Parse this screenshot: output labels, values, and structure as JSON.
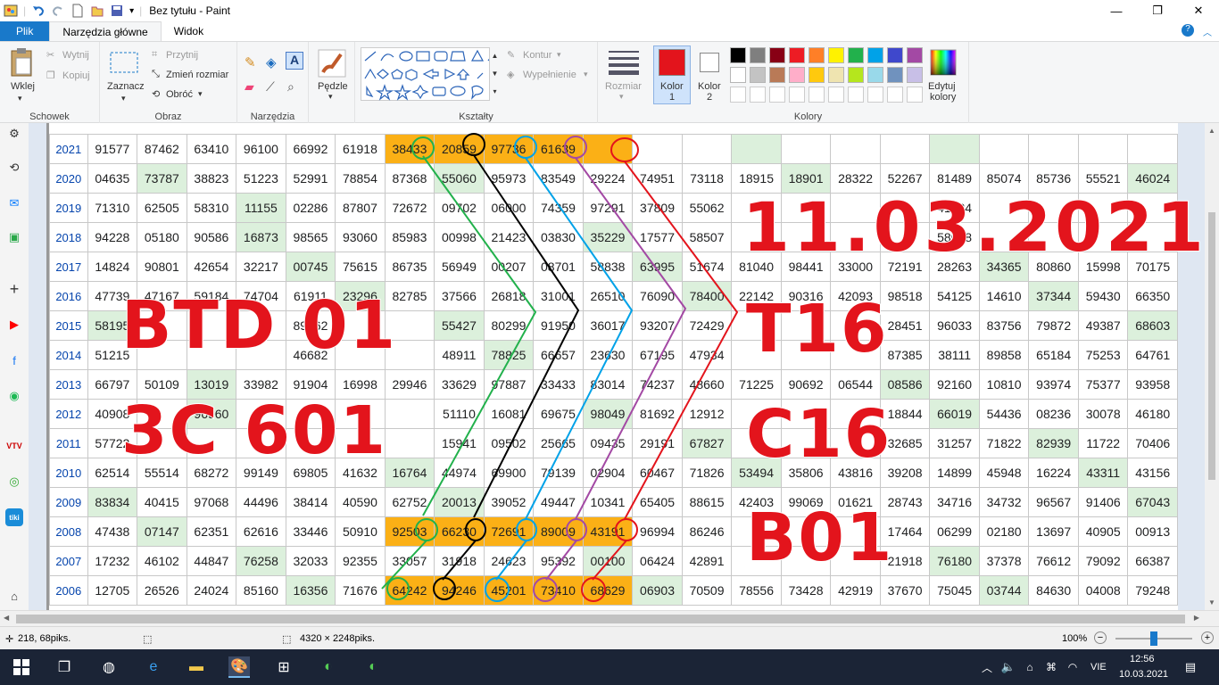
{
  "window": {
    "title": "Bez tytułu - Paint",
    "minimize": "—",
    "maximize": "❐",
    "close": "✕"
  },
  "tabs": [
    {
      "label": "Plik"
    },
    {
      "label": "Narzędzia główne"
    },
    {
      "label": "Widok"
    }
  ],
  "ribbon": {
    "clipboard": {
      "paste": "Wklej",
      "cut": "Wytnij",
      "copy": "Kopiuj",
      "group": "Schowek"
    },
    "image": {
      "select": "Zaznacz",
      "crop": "Przytnij",
      "resize": "Zmień rozmiar",
      "rotate": "Obróć",
      "group": "Obraz"
    },
    "tools": {
      "group": "Narzędzia"
    },
    "brushes": {
      "label": "Pędzle"
    },
    "shapes": {
      "outline": "Kontur",
      "fill": "Wypełnienie",
      "group": "Kształty"
    },
    "size": {
      "label": "Rozmiar"
    },
    "colors": {
      "color1": "Kolor",
      "color1_num": "1",
      "color2": "Kolor",
      "color2_num": "2",
      "edit": "Edytuj",
      "edit2": "kolory",
      "group": "Kolory",
      "color1_value": "#e3141c",
      "color2_value": "#ffffff",
      "palette": [
        "#000000",
        "#7f7f7f",
        "#880015",
        "#ed1c24",
        "#ff7f27",
        "#fff200",
        "#22b14c",
        "#00a2e8",
        "#3f48cc",
        "#a349a4",
        "#ffffff",
        "#c3c3c3",
        "#b97a57",
        "#ffaec9",
        "#ffc90e",
        "#efe4b0",
        "#b5e61d",
        "#99d9ea",
        "#7092be",
        "#c8bfe7"
      ]
    }
  },
  "table": {
    "years": [
      "2021",
      "2020",
      "2019",
      "2018",
      "2017",
      "2016",
      "2015",
      "2014",
      "2013",
      "2012",
      "2011",
      "2010",
      "2009",
      "2008",
      "2007",
      "2006"
    ],
    "rows": [
      [
        "91577",
        "87462",
        "63410",
        "96100",
        "66992",
        "61918",
        "38433",
        "20859",
        "97736",
        "61639",
        "",
        "",
        "",
        "",
        "",
        "",
        "",
        "",
        "",
        "",
        ""
      ],
      [
        "04635",
        "73787",
        "38823",
        "51223",
        "52991",
        "78854",
        "87368",
        "55060",
        "95973",
        "83549",
        "29224",
        "74951",
        "73118",
        "18915",
        "18901",
        "28322",
        "52267",
        "81489",
        "85074",
        "85736",
        "55521",
        "46024"
      ],
      [
        "71310",
        "62505",
        "58310",
        "11155",
        "02286",
        "87807",
        "72672",
        "09702",
        "06000",
        "74359",
        "97291",
        "37809",
        "55062",
        "",
        "",
        "",
        "",
        "41334",
        "",
        "",
        "",
        ""
      ],
      [
        "94228",
        "05180",
        "90586",
        "16873",
        "98565",
        "93060",
        "85983",
        "00998",
        "21423",
        "03830",
        "35229",
        "17577",
        "58507",
        "",
        "",
        "",
        "",
        "58038",
        "",
        "",
        "",
        ""
      ],
      [
        "14824",
        "90801",
        "42654",
        "32217",
        "00745",
        "75615",
        "86735",
        "56949",
        "00207",
        "08701",
        "58838",
        "63995",
        "51674",
        "81040",
        "98441",
        "33000",
        "72191",
        "28263",
        "34365",
        "80860",
        "15998",
        "70175"
      ],
      [
        "47739",
        "47167",
        "59184",
        "74704",
        "61911",
        "23296",
        "82785",
        "37566",
        "26818",
        "31001",
        "26510",
        "76090",
        "78400",
        "22142",
        "90316",
        "42093",
        "98518",
        "54125",
        "14610",
        "37344",
        "59430",
        "66350"
      ],
      [
        "58195",
        "",
        "",
        "",
        "89462",
        "",
        "",
        "55427",
        "80299",
        "91950",
        "36017",
        "93207",
        "72429",
        "",
        "",
        "",
        "28451",
        "96033",
        "83756",
        "79872",
        "49387",
        "68603"
      ],
      [
        "51215",
        "",
        "",
        "",
        "46682",
        "",
        "",
        "48911",
        "78825",
        "66657",
        "23630",
        "67195",
        "47934",
        "",
        "",
        "",
        "87385",
        "38111",
        "89858",
        "65184",
        "75253",
        "64761"
      ],
      [
        "66797",
        "50109",
        "13019",
        "33982",
        "91904",
        "16998",
        "29946",
        "33629",
        "97887",
        "33433",
        "83014",
        "74237",
        "48660",
        "71225",
        "90692",
        "06544",
        "08586",
        "92160",
        "10810",
        "93974",
        "75377",
        "93958"
      ],
      [
        "40908",
        "",
        "96960",
        "",
        "",
        "",
        "",
        "51110",
        "16081",
        "69675",
        "98049",
        "81692",
        "12912",
        "",
        "",
        "",
        "18844",
        "66019",
        "54436",
        "08236",
        "30078",
        "46180"
      ],
      [
        "57722",
        "",
        "",
        "",
        "",
        "",
        "",
        "15941",
        "09502",
        "25665",
        "09435",
        "29191",
        "67827",
        "",
        "",
        "",
        "32685",
        "31257",
        "71822",
        "82939",
        "11722",
        "70406"
      ],
      [
        "62514",
        "55514",
        "68272",
        "99149",
        "69805",
        "41632",
        "16764",
        "44974",
        "69900",
        "79139",
        "02904",
        "60467",
        "71826",
        "53494",
        "35806",
        "43816",
        "39208",
        "14899",
        "45948",
        "16224",
        "43311",
        "43156"
      ],
      [
        "83834",
        "40415",
        "97068",
        "44496",
        "38414",
        "40590",
        "62752",
        "20013",
        "39052",
        "49447",
        "10341",
        "65405",
        "88615",
        "42403",
        "99069",
        "01621",
        "28743",
        "34716",
        "34732",
        "96567",
        "91406",
        "67043"
      ],
      [
        "47438",
        "07147",
        "62351",
        "62616",
        "33446",
        "50910",
        "92503",
        "66230",
        "72691",
        "89009",
        "43191",
        "96994",
        "86246",
        "",
        "",
        "",
        "17464",
        "06299",
        "02180",
        "13697",
        "40905",
        "00913"
      ],
      [
        "17232",
        "46102",
        "44847",
        "76258",
        "32033",
        "92355",
        "33057",
        "31918",
        "24623",
        "95392",
        "00100",
        "06424",
        "42891",
        "",
        "",
        "",
        "21918",
        "76180",
        "37378",
        "76612",
        "79092",
        "66387"
      ],
      [
        "12705",
        "26526",
        "24024",
        "85160",
        "16356",
        "71676",
        "64242",
        "94246",
        "45201",
        "73410",
        "68629",
        "06903",
        "70509",
        "78556",
        "73428",
        "42919",
        "37670",
        "75045",
        "03744",
        "84630",
        "04008",
        "79248"
      ]
    ]
  },
  "overlay": {
    "line1": "BTD 01",
    "line2": "3C 601",
    "date": "11.03.2021",
    "t": "T16",
    "c": "C16",
    "b": "B01"
  },
  "status": {
    "cursor": "218, 68piks.",
    "size": "4320 × 2248piks.",
    "zoom": "100%"
  },
  "taskbar": {
    "lang": "VIE",
    "time": "12:56",
    "date": "10.03.2021"
  }
}
